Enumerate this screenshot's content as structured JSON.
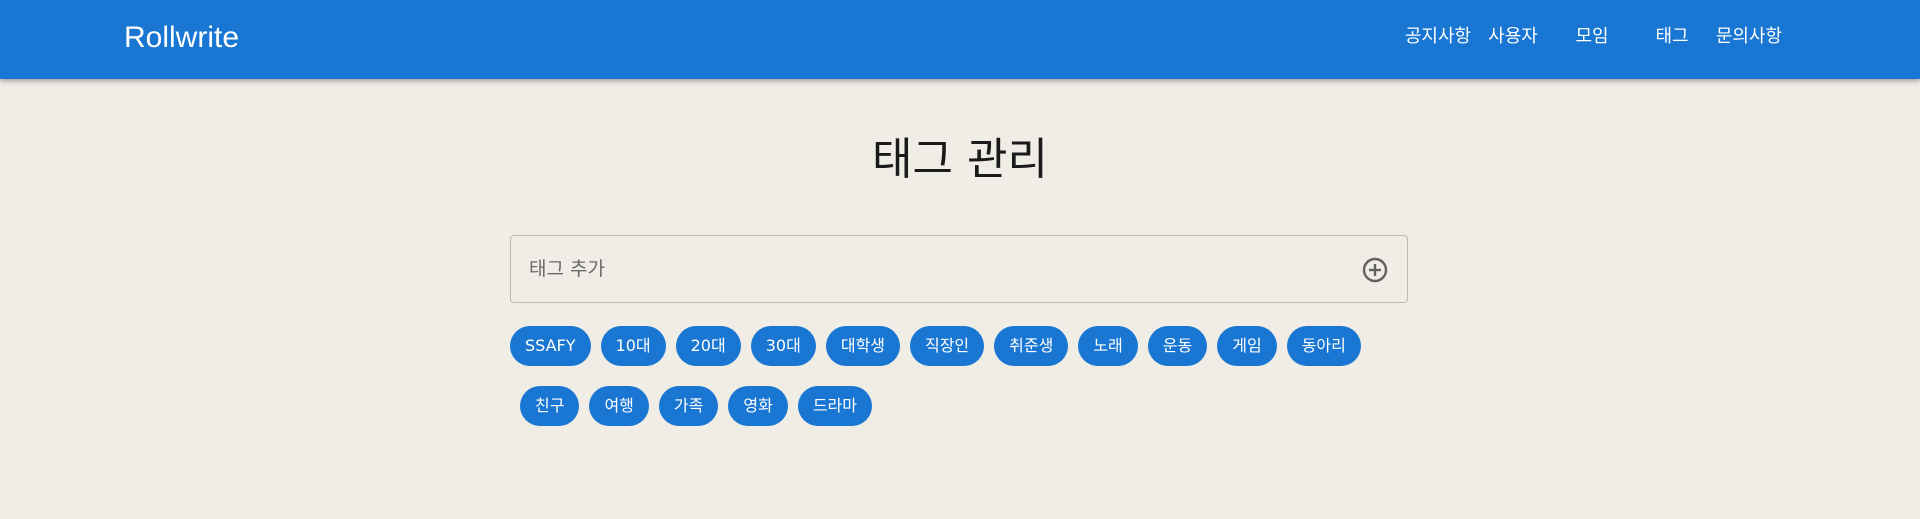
{
  "navbar": {
    "brand": "Rollwrite",
    "links": [
      "공지사항",
      "사용자",
      "모임",
      "태그",
      "문의사항"
    ]
  },
  "main": {
    "title": "태그 관리",
    "tag_input": {
      "placeholder": "태그 추가",
      "value": "",
      "add_icon": "add-circle-outline-icon"
    },
    "tags_row1": [
      "SSAFY",
      "10대",
      "20대",
      "30대",
      "대학생",
      "직장인",
      "취준생",
      "노래",
      "운동",
      "게임",
      "동아리"
    ],
    "tags_row2": [
      "친구",
      "여행",
      "가족",
      "영화",
      "드라마"
    ]
  },
  "colors": {
    "primary": "#1976d2",
    "background": "#f0ece6",
    "title_text": "#1a1a1a"
  }
}
